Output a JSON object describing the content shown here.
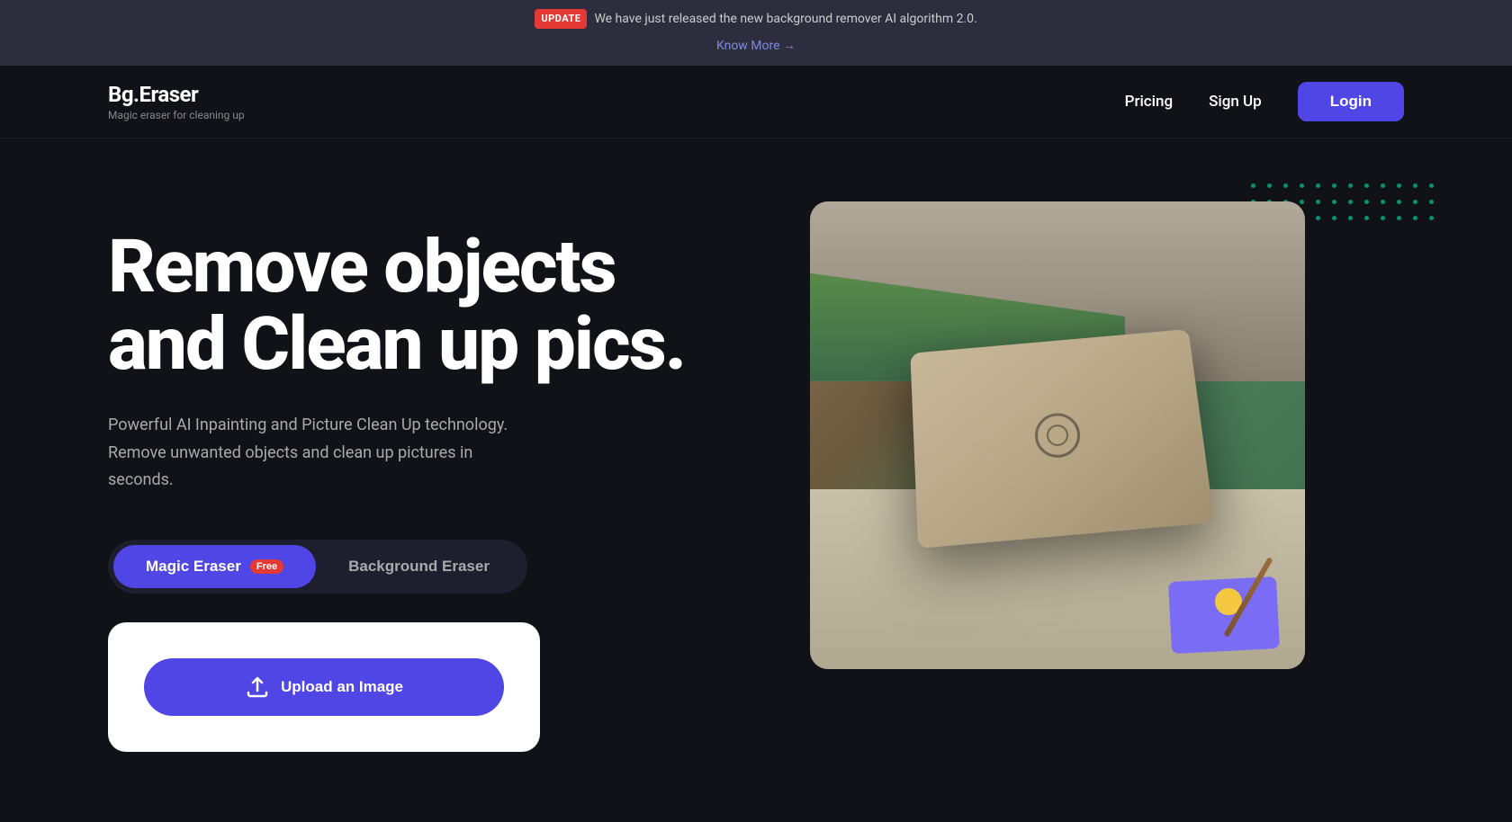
{
  "announcement": {
    "badge": "UPDATE",
    "message": "We have just released the new background remover AI algorithm 2.0.",
    "link_text": "Know More →",
    "link_url": "#"
  },
  "nav": {
    "logo_title": "Bg.Eraser",
    "logo_subtitle": "Magic eraser for cleaning up",
    "pricing_label": "Pricing",
    "signup_label": "Sign Up",
    "login_label": "Login"
  },
  "hero": {
    "title": "Remove objects and Clean up pics.",
    "description": "Powerful AI Inpainting and Picture Clean Up technology. Remove unwanted objects and clean up pictures in seconds.",
    "tab_magic_eraser": "Magic Eraser",
    "tab_magic_eraser_badge": "Free",
    "tab_background_eraser": "Background Eraser",
    "upload_button_label": "Upload an Image"
  },
  "dots": {
    "count": 36,
    "color": "#00c896"
  }
}
